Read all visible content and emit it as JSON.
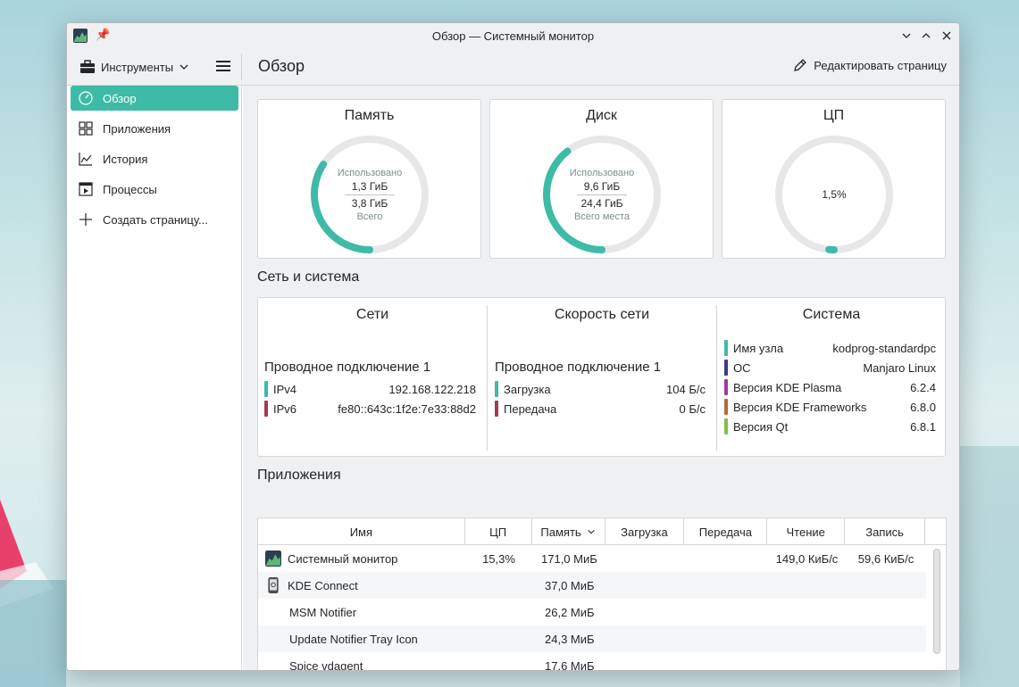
{
  "window": {
    "title": "Обзор — Системный монитор"
  },
  "toolbar": {
    "tools_label": "Инструменты",
    "page_title": "Обзор",
    "edit_label": "Редактировать страницу"
  },
  "sidebar": {
    "items": [
      {
        "label": "Обзор",
        "icon": "gauge-icon",
        "active": true
      },
      {
        "label": "Приложения",
        "icon": "grid-icon"
      },
      {
        "label": "История",
        "icon": "chart-icon"
      },
      {
        "label": "Процессы",
        "icon": "process-icon"
      },
      {
        "label": "Создать страницу...",
        "icon": "plus-icon"
      }
    ]
  },
  "cards": {
    "memory": {
      "title": "Память",
      "used_label": "Использовано",
      "used": "1,3 ГиБ",
      "total": "3,8 ГиБ",
      "total_label": "Всего",
      "fraction": 0.342
    },
    "disk": {
      "title": "Диск",
      "used_label": "Использовано",
      "used": "9,6 ГиБ",
      "total": "24,4 ГиБ",
      "total_label": "Всего места",
      "fraction": 0.393
    },
    "cpu": {
      "title": "ЦП",
      "value": "1,5%",
      "fraction": 0.015
    }
  },
  "network_system": {
    "section_title": "Сеть и система",
    "networks": {
      "title": "Сети",
      "connection": "Проводное подключение 1",
      "rows": [
        {
          "key": "IPv4",
          "value": "192.168.122.218",
          "color": "#3dbba6"
        },
        {
          "key": "IPv6",
          "value": "fe80::643c:1f2e:7e33:88d2",
          "color": "#a8384f"
        }
      ]
    },
    "speed": {
      "title": "Скорость сети",
      "connection": "Проводное подключение 1",
      "rows": [
        {
          "key": "Загрузка",
          "value": "104 Б/с",
          "color": "#3dbba6"
        },
        {
          "key": "Передача",
          "value": "0 Б/с",
          "color": "#a8384f"
        }
      ]
    },
    "system": {
      "title": "Система",
      "rows": [
        {
          "key": "Имя узла",
          "value": "kodprog-standardpc",
          "color": "#3dbba6"
        },
        {
          "key": "ОС",
          "value": "Manjaro Linux",
          "color": "#3b3b86"
        },
        {
          "key": "Версия KDE Plasma",
          "value": "6.2.4",
          "color": "#9c3e9c"
        },
        {
          "key": "Версия KDE Frameworks",
          "value": "6.8.0",
          "color": "#b56b3b"
        },
        {
          "key": "Версия Qt",
          "value": "6.8.1",
          "color": "#7fbf4d"
        }
      ]
    }
  },
  "apps": {
    "section_title": "Приложения",
    "columns": [
      "Имя",
      "ЦП",
      "Память",
      "Загрузка",
      "Передача",
      "Чтение",
      "Запись"
    ],
    "rows": [
      {
        "name": "Системный монитор",
        "cpu": "15,3%",
        "mem": "171,0 МиБ",
        "down": "",
        "up": "",
        "read": "149,0 КиБ/с",
        "write": "59,6 КиБ/с",
        "icon": "system-monitor-icon"
      },
      {
        "name": "KDE Connect",
        "cpu": "",
        "mem": "37,0 МиБ",
        "down": "",
        "up": "",
        "read": "",
        "write": "",
        "icon": "kde-connect-icon"
      },
      {
        "name": "MSM Notifier",
        "cpu": "",
        "mem": "26,2 МиБ",
        "down": "",
        "up": "",
        "read": "",
        "write": "",
        "icon": ""
      },
      {
        "name": "Update Notifier Tray Icon",
        "cpu": "",
        "mem": "24,3 МиБ",
        "down": "",
        "up": "",
        "read": "",
        "write": "",
        "icon": ""
      },
      {
        "name": "Spice vdagent",
        "cpu": "",
        "mem": "17,6 МиБ",
        "down": "",
        "up": "",
        "read": "",
        "write": "",
        "icon": ""
      }
    ]
  },
  "colors": {
    "accent": "#3dbba6",
    "track": "#e6e7e8"
  }
}
